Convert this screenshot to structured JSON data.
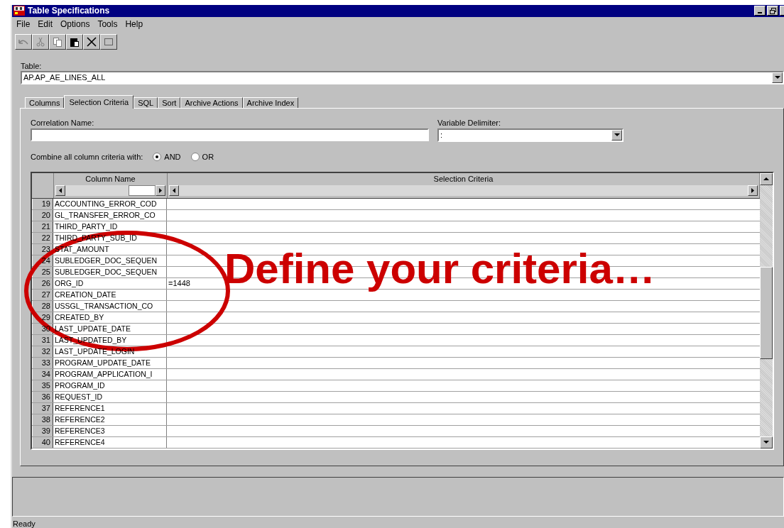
{
  "window": {
    "title": "Table Specifications"
  },
  "menu": [
    {
      "label": "File"
    },
    {
      "label": "Edit"
    },
    {
      "label": "Options"
    },
    {
      "label": "Tools"
    },
    {
      "label": "Help"
    }
  ],
  "toolbar": [
    {
      "kind": "undo",
      "disabled": true
    },
    {
      "kind": "cut",
      "disabled": true
    },
    {
      "kind": "copy",
      "disabled": true
    },
    {
      "kind": "paste",
      "disabled": false
    },
    {
      "kind": "delete",
      "disabled": false
    },
    {
      "kind": "select",
      "disabled": false
    }
  ],
  "table_field": {
    "label": "Table:",
    "value": "AP.AP_AE_LINES_ALL"
  },
  "tabs": [
    {
      "label": "Columns",
      "selected": false
    },
    {
      "label": "Selection Criteria",
      "selected": true
    },
    {
      "label": "SQL",
      "selected": false
    },
    {
      "label": "Sort",
      "selected": false
    },
    {
      "label": "Archive Actions",
      "selected": false
    },
    {
      "label": "Archive Index",
      "selected": false
    }
  ],
  "correlation_name": {
    "label": "Correlation Name:"
  },
  "variable_delimiter": {
    "label": "Variable Delimiter:",
    "value": ":"
  },
  "combine": {
    "label": "Combine all column criteria with:",
    "options": [
      {
        "label": "AND",
        "selected": true
      },
      {
        "label": "OR",
        "selected": false
      }
    ]
  },
  "grid": {
    "columns": [
      "Column Name",
      "Selection Criteria"
    ],
    "rows": [
      {
        "number": "19",
        "column_name": "ACCOUNTING_ERROR_COD"
      },
      {
        "number": "20",
        "column_name": "GL_TRANSFER_ERROR_CO"
      },
      {
        "number": "21",
        "column_name": "THIRD_PARTY_ID"
      },
      {
        "number": "22",
        "column_name": "THIRD_PARTY_SUB_ID"
      },
      {
        "number": "23",
        "column_name": "STAT_AMOUNT"
      },
      {
        "number": "24",
        "column_name": "SUBLEDGER_DOC_SEQUEN"
      },
      {
        "number": "25",
        "column_name": "SUBLEDGER_DOC_SEQUEN"
      },
      {
        "number": "26",
        "column_name": "ORG_ID",
        "criteria": "=1448"
      },
      {
        "number": "27",
        "column_name": "CREATION_DATE"
      },
      {
        "number": "28",
        "column_name": "USSGL_TRANSACTION_CO"
      },
      {
        "number": "29",
        "column_name": "CREATED_BY"
      },
      {
        "number": "30",
        "column_name": "LAST_UPDATE_DATE"
      },
      {
        "number": "31",
        "column_name": "LAST_UPDATED_BY"
      },
      {
        "number": "32",
        "column_name": "LAST_UPDATE_LOGIN"
      },
      {
        "number": "33",
        "column_name": "PROGRAM_UPDATE_DATE"
      },
      {
        "number": "34",
        "column_name": "PROGRAM_APPLICATION_I"
      },
      {
        "number": "35",
        "column_name": "PROGRAM_ID"
      },
      {
        "number": "36",
        "column_name": "REQUEST_ID"
      },
      {
        "number": "37",
        "column_name": "REFERENCE1"
      },
      {
        "number": "38",
        "column_name": "REFERENCE2"
      },
      {
        "number": "39",
        "column_name": "REFERENCE3"
      },
      {
        "number": "40",
        "column_name": "REFERENCE4"
      }
    ]
  },
  "status_bar": {
    "text": "Ready"
  },
  "annotation": {
    "text": "Define your criteria…"
  }
}
